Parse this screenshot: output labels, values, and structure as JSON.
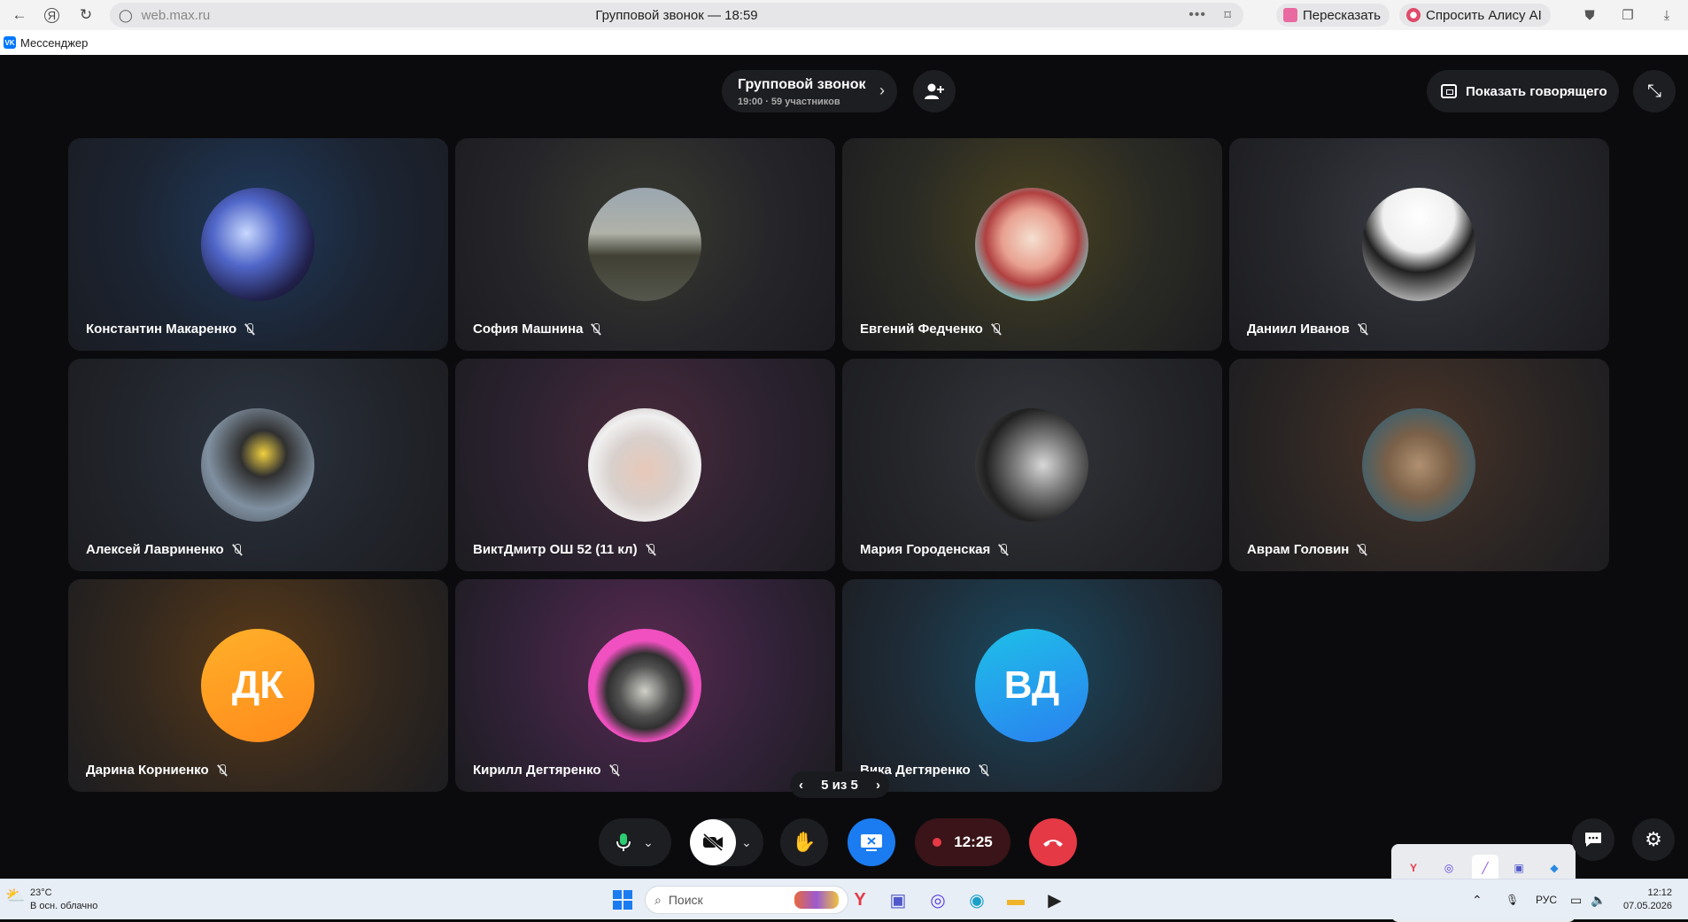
{
  "browser": {
    "url": "web.max.ru",
    "page_title": "Групповой звонок — 18:59",
    "retell_label": "Пересказать",
    "alice_label": "Спросить Алису AI",
    "bookmark_label": "Мессенджер"
  },
  "call": {
    "title": "Групповой звонок",
    "subtitle": "19:00 · 59 участников",
    "show_speaker_label": "Показать говорящего",
    "pager_label": "5 из 5",
    "record_timer": "12:25"
  },
  "participants": [
    {
      "name": "Константин Макаренко",
      "muted": true,
      "avatar_type": "photo"
    },
    {
      "name": "София Машнина",
      "muted": true,
      "avatar_type": "photo"
    },
    {
      "name": "Евгений Федченко",
      "muted": true,
      "avatar_type": "photo"
    },
    {
      "name": "Даниил Иванов",
      "muted": true,
      "avatar_type": "photo"
    },
    {
      "name": "Алексей Лавриненко",
      "muted": true,
      "avatar_type": "photo"
    },
    {
      "name": "ВиктДмитр ОШ 52 (11 кл)",
      "muted": true,
      "avatar_type": "photo"
    },
    {
      "name": "Мария Городенская",
      "muted": true,
      "avatar_type": "photo"
    },
    {
      "name": "Аврам Головин",
      "muted": true,
      "avatar_type": "photo"
    },
    {
      "name": "Дарина Корниенко",
      "muted": true,
      "avatar_type": "initials",
      "initials": "ДК",
      "color": "#ff9a1f"
    },
    {
      "name": "Кирилл Дегтяренко",
      "muted": true,
      "avatar_type": "photo"
    },
    {
      "name": "Вика Дегтяренко",
      "muted": true,
      "avatar_type": "initials",
      "initials": "ВД",
      "color": "#1ea0f0"
    }
  ],
  "taskbar": {
    "weather_temp": "23°C",
    "weather_desc": "В осн. облачно",
    "search_placeholder": "Поиск",
    "language": "РУС",
    "time": "12:12",
    "date": "07.05.2026"
  },
  "colors": {
    "accent_blue": "#1a7cf0",
    "hangup_red": "#e63946",
    "record_bg": "#3a1418"
  }
}
